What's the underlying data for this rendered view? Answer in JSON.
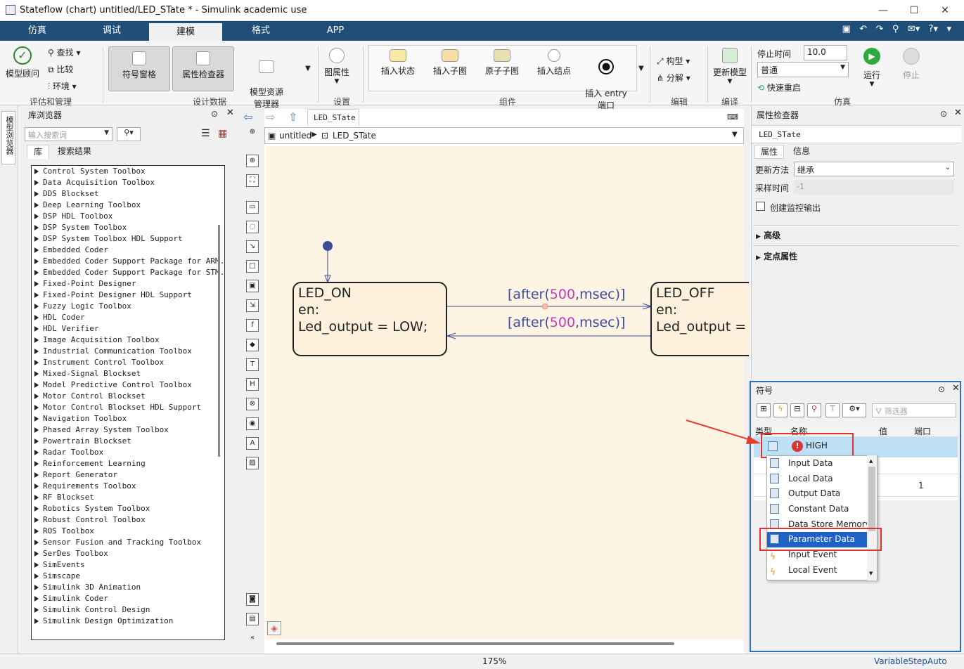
{
  "window": {
    "title": "Stateflow (chart) untitled/LED_STate * - Simulink academic use"
  },
  "tabs": [
    "仿真",
    "调试",
    "建模",
    "格式",
    "APP"
  ],
  "ribbon": {
    "eval": {
      "model_advisor": "模型顾问",
      "find": "查找",
      "compare": "比较",
      "env": "环境",
      "group": "评估和管理"
    },
    "design": {
      "symbols": "符号窗格",
      "prop_inspector": "属性检查器",
      "model_explorer": "模型资源\n管理器",
      "group": "设计数据"
    },
    "setup": {
      "props": "图属性",
      "group": "设置"
    },
    "components": {
      "insert_state": "插入状态",
      "insert_subchart": "插入子图",
      "atomic_subchart": "原子子图",
      "insert_junction": "插入结点",
      "insert_entry": "插入 entry\n端口",
      "group": "组件"
    },
    "edit": {
      "construct": "构型",
      "decompose": "分解",
      "group": "编辑"
    },
    "compile": {
      "update": "更新模型",
      "group": "编译"
    },
    "sim": {
      "stop_time_label": "停止时间",
      "stop_time": "10.0",
      "mode": "普通",
      "fast_restart": "快速重启",
      "run": "运行",
      "stop": "停止",
      "group": "仿真"
    }
  },
  "left_strip": {
    "label": "模型浏览器"
  },
  "library": {
    "title": "库浏览器",
    "search_placeholder": "输入搜索词",
    "tab_lib": "库",
    "tab_results": "搜索结果",
    "items": [
      "Control System Toolbox",
      "Data Acquisition Toolbox",
      "DDS Blockset",
      "Deep Learning Toolbox",
      "DSP HDL Toolbox",
      "DSP System Toolbox",
      "DSP System Toolbox HDL Support",
      "Embedded Coder",
      "Embedded Coder Support Package for ARM...",
      "Embedded Coder Support Package for STM...",
      "Fixed-Point Designer",
      "Fixed-Point Designer HDL Support",
      "Fuzzy Logic Toolbox",
      "HDL Coder",
      "HDL Verifier",
      "Image Acquisition Toolbox",
      "Industrial Communication Toolbox",
      "Instrument Control Toolbox",
      "Mixed-Signal Blockset",
      "Model Predictive Control Toolbox",
      "Motor Control Blockset",
      "Motor Control Blockset HDL Support",
      "Navigation Toolbox",
      "Phased Array System Toolbox",
      "Powertrain Blockset",
      "Radar Toolbox",
      "Reinforcement Learning",
      "Report Generator",
      "Requirements Toolbox",
      "RF Blockset",
      "Robotics System Toolbox",
      "Robust Control Toolbox",
      "ROS Toolbox",
      "Sensor Fusion and Tracking Toolbox",
      "SerDes Toolbox",
      "SimEvents",
      "Simscape",
      "Simulink 3D Animation",
      "Simulink Coder",
      "Simulink Control Design",
      "Simulink Design Optimization"
    ]
  },
  "editor": {
    "tab": "LED_STate",
    "crumb_root": "untitled",
    "crumb_chart": "LED_STate",
    "zoom": "175%"
  },
  "chart": {
    "state_on": {
      "name": "LED_ON",
      "line1": "en:",
      "line2": "Led_output = LOW;"
    },
    "state_off": {
      "name": "LED_OFF",
      "line1": "en:",
      "line2": "Led_output ="
    },
    "t1": {
      "pre": "[after(",
      "num": "500",
      "post": ",msec)]"
    },
    "t2": {
      "pre": "[after(",
      "num": "500",
      "post": ",msec)]"
    }
  },
  "inspector": {
    "title": "属性检查器",
    "object": "LED_STate",
    "tab_props": "属性",
    "tab_info": "信息",
    "update_label": "更新方法",
    "update_value": "继承",
    "sample_label": "采样时间",
    "sample_value": "-1",
    "monitor": "创建监控输出",
    "advanced": "高级",
    "fixed_point": "定点属性"
  },
  "symbols": {
    "title": "符号",
    "filter_placeholder": "筛选器",
    "cols": [
      "类型",
      "名称",
      "值",
      "端口"
    ],
    "row1_name": "HIGH",
    "row3_port": "1",
    "menu": [
      "Input Data",
      "Local Data",
      "Output Data",
      "Constant Data",
      "Data Store Memory",
      "Parameter Data",
      "Input Event",
      "Local Event"
    ]
  },
  "status": {
    "solver": "VariableStepAuto"
  }
}
